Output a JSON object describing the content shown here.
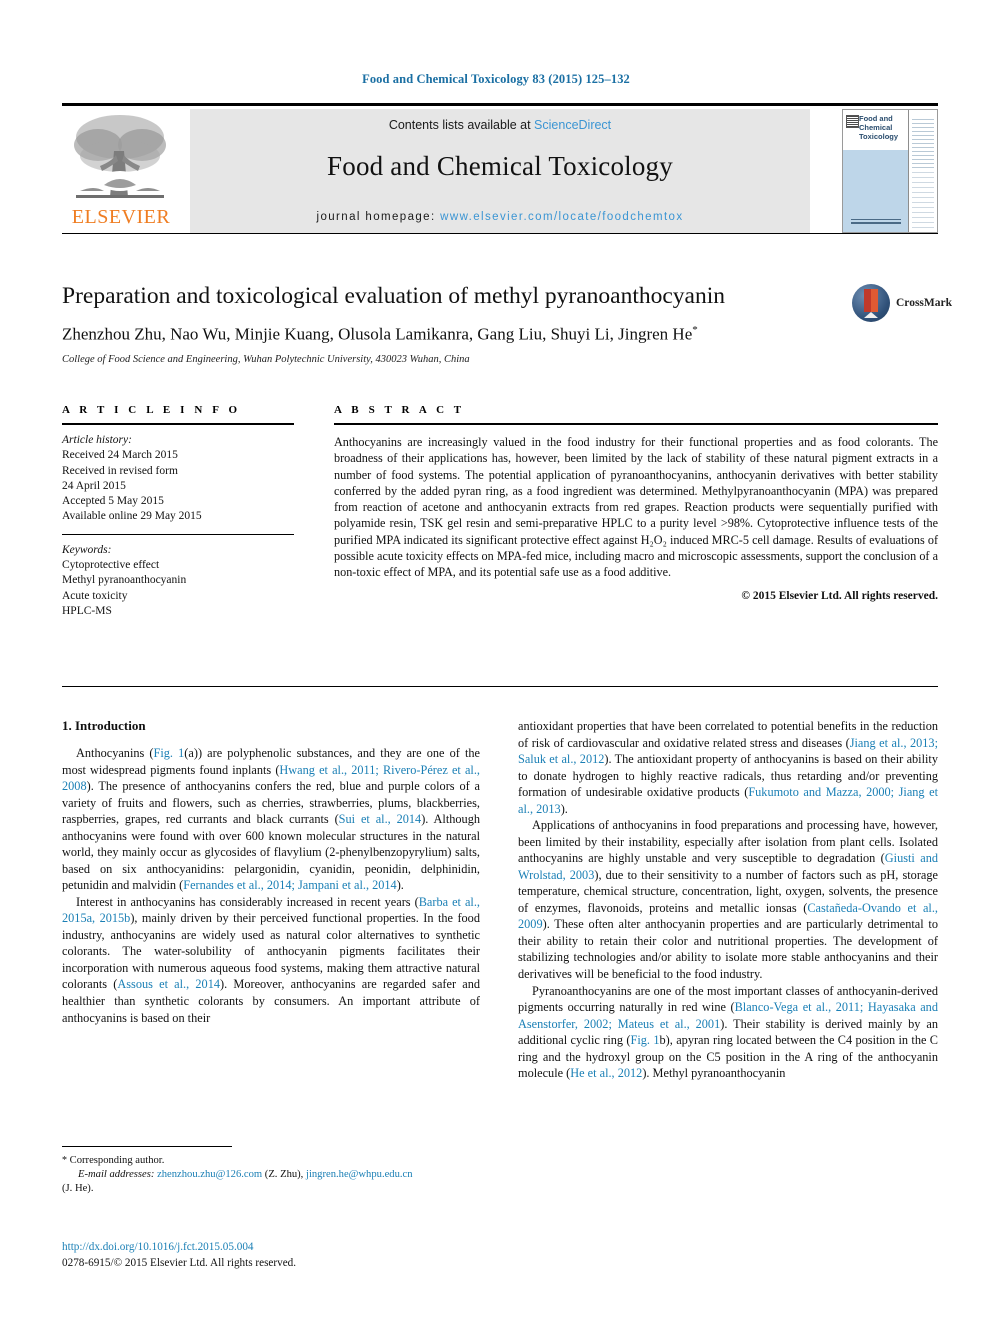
{
  "running_head": "Food and Chemical Toxicology 83 (2015) 125–132",
  "masthead": {
    "contents_text": "Contents lists available at ",
    "sciencedirect": "ScienceDirect",
    "journal_title": "Food and Chemical Toxicology",
    "homepage_label": "journal homepage: ",
    "homepage_url": "www.elsevier.com/locate/foodchemtox",
    "publisher": "ELSEVIER",
    "cover_title": "Food and Chemical Toxicology"
  },
  "article": {
    "title": "Preparation and toxicological evaluation of methyl pyranoanthocyanin",
    "authors": "Zhenzhou Zhu, Nao Wu, Minjie Kuang, Olusola Lamikanra, Gang Liu, Shuyi Li, Jingren He",
    "author_marker": "*",
    "affiliation": "College of Food Science and Engineering, Wuhan Polytechnic University, 430023 Wuhan, China",
    "crossmark_label": "CrossMark"
  },
  "article_info": {
    "heading": "A R T I C L E   I N F O",
    "history_label": "Article history:",
    "history": [
      "Received 24 March 2015",
      "Received in revised form",
      "24 April 2015",
      "Accepted 5 May 2015",
      "Available online 29 May 2015"
    ],
    "keywords_label": "Keywords:",
    "keywords": [
      "Cytoprotective effect",
      "Methyl pyranoanthocyanin",
      "Acute toxicity",
      "HPLC-MS"
    ]
  },
  "abstract": {
    "heading": "A B S T R A C T",
    "text": "Anthocyanins are increasingly valued in the food industry for their functional properties and as food colorants. The broadness of their applications has, however, been limited by the lack of stability of these natural pigment extracts in a number of food systems. The potential application of pyranoanthocyanins, anthocyanin derivatives with better stability conferred by the added pyran ring, as a food ingredient was determined. Methylpyranoanthocyanin (MPA) was prepared from reaction of acetone and anthocyanin extracts from red grapes. Reaction products were sequentially purified with polyamide resin, TSK gel resin and semi-preparative HPLC to a purity level >98%. Cytoprotective influence tests of the purified MPA indicated its significant protective effect against H₂O₂ induced MRC-5 cell damage. Results of evaluations of possible acute toxicity effects on MPA-fed mice, including macro and microscopic assessments, support the conclusion of a non-toxic effect of MPA, and its potential safe use as a food additive.",
    "copyright": "© 2015 Elsevier Ltd. All rights reserved."
  },
  "body": {
    "section_title": "1. Introduction",
    "left_paragraphs": [
      {
        "parts": [
          {
            "t": "Anthocyanins (",
            "link": false
          },
          {
            "t": "Fig. 1",
            "link": true
          },
          {
            "t": "(a)) are polyphenolic substances, and they are one of the most widespread pigments found inplants (",
            "link": false
          },
          {
            "t": "Hwang et al., 2011; Rivero-Pérez et al., 2008",
            "link": true
          },
          {
            "t": "). The presence of anthocyanins confers the red, blue and purple colors of a variety of fruits and flowers, such as cherries, strawberries, plums, blackberries, raspberries, grapes, red currants and black currants (",
            "link": false
          },
          {
            "t": "Sui et al., 2014",
            "link": true
          },
          {
            "t": "). Although anthocyanins were found with over 600 known molecular structures in the natural world, they mainly occur as glycosides of flavylium (2-phenylbenzopyrylium) salts, based on six anthocyanidins: pelargonidin, cyanidin, peonidin, delphinidin, petunidin and malvidin (",
            "link": false
          },
          {
            "t": "Fernandes et al., 2014; Jampani et al., 2014",
            "link": true
          },
          {
            "t": ").",
            "link": false
          }
        ]
      },
      {
        "parts": [
          {
            "t": "Interest in anthocyanins has considerably increased in recent years (",
            "link": false
          },
          {
            "t": "Barba et al., 2015a, 2015b",
            "link": true
          },
          {
            "t": "), mainly driven by their perceived functional properties. In the food industry, anthocyanins are widely used as natural color alternatives to synthetic colorants. The water-solubility of anthocyanin pigments facilitates their incorporation with numerous aqueous food systems, making them attractive natural colorants (",
            "link": false
          },
          {
            "t": "Assous et al., 2014",
            "link": true
          },
          {
            "t": "). Moreover, anthocyanins are regarded safer and healthier than synthetic colorants by consumers. An important attribute of anthocyanins is based on their",
            "link": false
          }
        ]
      }
    ],
    "right_paragraphs": [
      {
        "parts": [
          {
            "t": "antioxidant properties that have been correlated to potential benefits in the reduction of risk of cardiovascular and oxidative related stress and diseases (",
            "link": false
          },
          {
            "t": "Jiang et al., 2013; Saluk et al., 2012",
            "link": true
          },
          {
            "t": "). The antioxidant property of anthocyanins is based on their ability to donate hydrogen to highly reactive radicals, thus retarding and/or preventing formation of undesirable oxidative products (",
            "link": false
          },
          {
            "t": "Fukumoto and Mazza, 2000; Jiang et al., 2013",
            "link": true
          },
          {
            "t": ").",
            "link": false
          }
        ],
        "first": true
      },
      {
        "parts": [
          {
            "t": "Applications of anthocyanins in food preparations and processing have, however, been limited by their instability, especially after isolation from plant cells. Isolated anthocyanins are highly unstable and very susceptible to degradation (",
            "link": false
          },
          {
            "t": "Giusti and Wrolstad, 2003",
            "link": true
          },
          {
            "t": "), due to their sensitivity to a number of factors such as pH, storage temperature, chemical structure, concentration, light, oxygen, solvents, the presence of enzymes, flavonoids, proteins and metallic ionsas (",
            "link": false
          },
          {
            "t": "Castañeda-Ovando et al., 2009",
            "link": true
          },
          {
            "t": "). These often alter anthocyanin properties and are particularly detrimental to their ability to retain their color and nutritional properties. The development of stabilizing technologies and/or ability to isolate more stable anthocyanins and their derivatives will be beneficial to the food industry.",
            "link": false
          }
        ]
      },
      {
        "parts": [
          {
            "t": "Pyranoanthocyanins are one of the most important classes of anthocyanin-derived pigments occurring naturally in red wine (",
            "link": false
          },
          {
            "t": "Blanco-Vega et al., 2011; Hayasaka and Asenstorfer, 2002; Mateus et al., 2001",
            "link": true
          },
          {
            "t": "). Their stability is derived mainly by an additional cyclic ring (",
            "link": false
          },
          {
            "t": "Fig. 1",
            "link": true
          },
          {
            "t": "b), apyran ring located between the C4 position in the C ring and the hydroxyl group on the C5 position in the A ring of the anthocyanin molecule (",
            "link": false
          },
          {
            "t": "He et al., 2012",
            "link": true
          },
          {
            "t": "). Methyl pyranoanthocyanin",
            "link": false
          }
        ]
      }
    ]
  },
  "footnote": {
    "corresponding": "Corresponding author.",
    "email_label": "E-mail addresses:",
    "email1": "zhenzhou.zhu@126.com",
    "email1_owner": "(Z. Zhu),",
    "email2": "jingren.he@whpu.edu.cn",
    "email2_owner": "(J. He).",
    "doi": "http://dx.doi.org/10.1016/j.fct.2015.05.004",
    "issn_line": "0278-6915/© 2015 Elsevier Ltd. All rights reserved."
  },
  "colors": {
    "link": "#1a7fb5",
    "sciencedirect": "#3b95d3",
    "elsevier_orange": "#ef7d22",
    "running_head": "#1a6fa3"
  }
}
